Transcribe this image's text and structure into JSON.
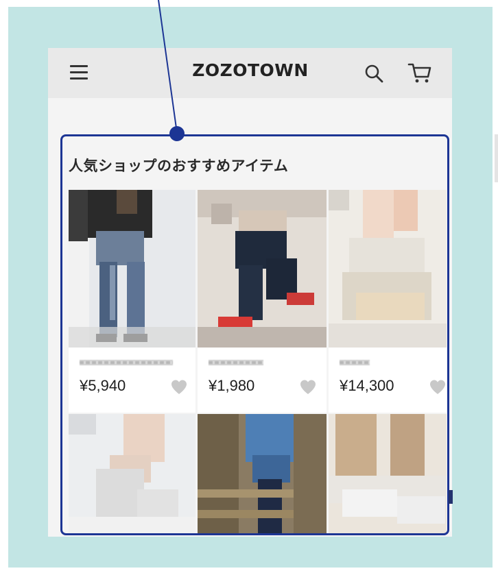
{
  "app": {
    "logo": "ZOZOTOWN",
    "icons": [
      "menu-icon",
      "search-icon",
      "cart-icon"
    ]
  },
  "section": {
    "title": "人気ショップのおすすめアイテム"
  },
  "products": [
    {
      "price": "¥5,940",
      "icon": "heart-icon"
    },
    {
      "price": "¥1,980",
      "icon": "heart-icon"
    },
    {
      "price": "¥14,300",
      "icon": "heart-icon"
    }
  ],
  "colors": {
    "callout": "#1c3594",
    "background_panel": "#c2e5e4",
    "heart": "#c8c8c8"
  }
}
